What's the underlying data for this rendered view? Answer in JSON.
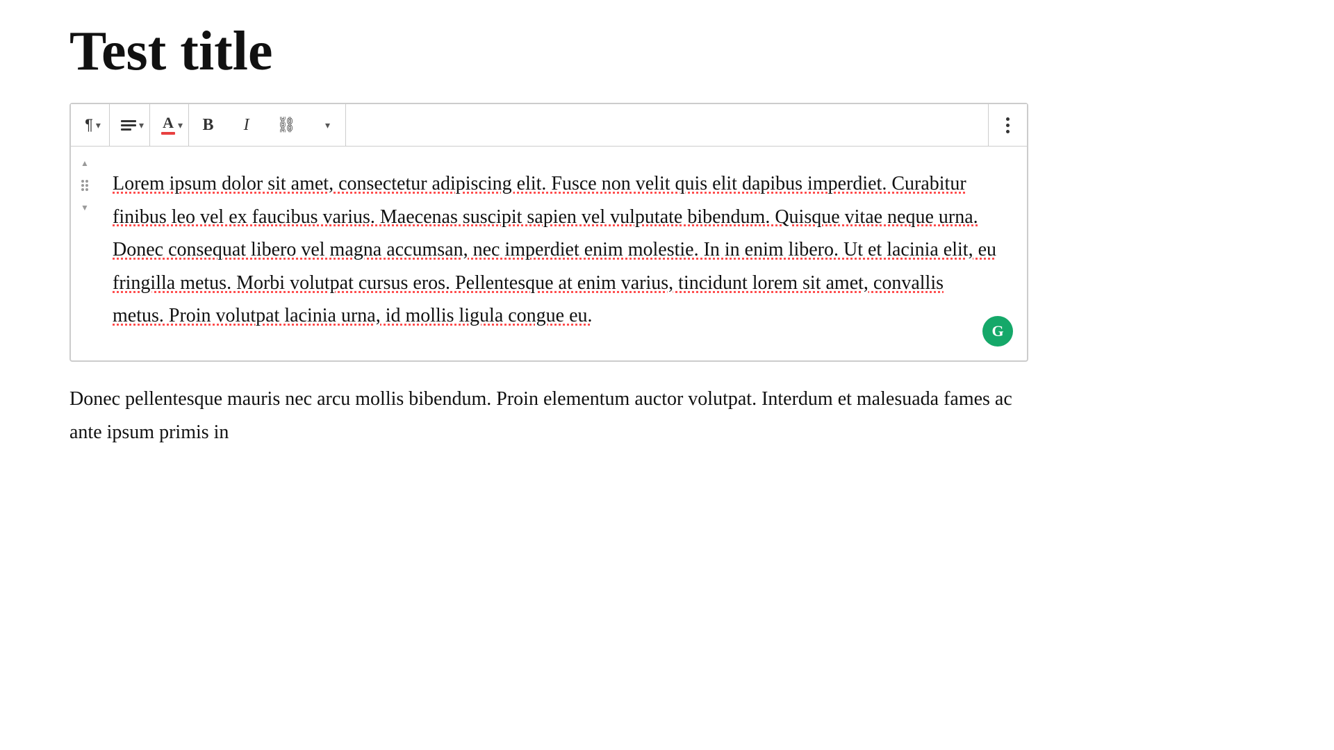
{
  "page": {
    "title": "Test title"
  },
  "toolbar": {
    "paragraph_icon": "¶",
    "paragraph_label": "Paragraph",
    "align_label": "Align",
    "text_color_label": "Text color",
    "text_color_letter": "A",
    "bold_label": "Bold",
    "bold_letter": "B",
    "italic_label": "Italic",
    "italic_letter": "I",
    "link_label": "Link",
    "more_label": "More options"
  },
  "editor": {
    "content_paragraph": "Lorem ipsum dolor sit amet, consectetur adipiscing elit. Fusce non velit quis elit dapibus imperdiet. Curabitur finibus leo vel ex faucibus varius. Maecenas suscipit sapien vel vulputate bibendum. Quisque vitae neque urna. Donec consequat libero vel magna accumsan, nec imperdiet enim molestie. In in enim libero. Ut et lacinia elit, eu fringilla metus. Morbi volutpat cursus eros. Pellentesque at enim varius, tincidunt lorem sit amet, convallis metus. Proin volutpat lacinia urna, id mollis ligula congue eu.",
    "below_paragraph": "Donec pellentesque mauris nec arcu mollis bibendum. Proin elementum auctor volutpat. Interdum et malesuada fames ac ante ipsum primis in"
  },
  "grammarly": {
    "icon": "G"
  },
  "left_controls": {
    "up_label": "Move up",
    "drag_label": "Drag",
    "down_label": "Move down"
  }
}
